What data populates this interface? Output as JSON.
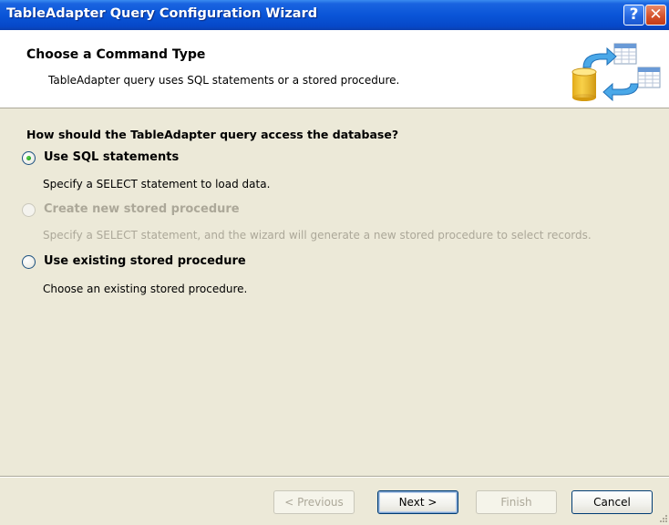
{
  "window": {
    "title": "TableAdapter Query Configuration Wizard",
    "help_glyph": "?",
    "close_glyph": "✕"
  },
  "header": {
    "title": "Choose a Command Type",
    "subtitle": "TableAdapter query uses SQL statements or a stored procedure.",
    "icon": "database-table-transfer-icon"
  },
  "content": {
    "question": "How should the TableAdapter query access the database?",
    "options": [
      {
        "label": "Use SQL statements",
        "description": "Specify a SELECT statement to load data.",
        "selected": true,
        "enabled": true
      },
      {
        "label": "Create new stored procedure",
        "description": "Specify a SELECT statement, and the wizard will generate a new stored procedure to select records.",
        "selected": false,
        "enabled": false
      },
      {
        "label": "Use existing stored procedure",
        "description": "Choose an existing stored procedure.",
        "selected": false,
        "enabled": true
      }
    ]
  },
  "footer": {
    "previous_label": "< Previous",
    "next_label": "Next >",
    "finish_label": "Finish",
    "cancel_label": "Cancel"
  },
  "colors": {
    "titlebar": "#0a55d8",
    "dialog_background": "#ece9d8",
    "header_background": "#ffffff",
    "disabled_text": "#aca899",
    "radio_selected_dot": "#21a121"
  }
}
